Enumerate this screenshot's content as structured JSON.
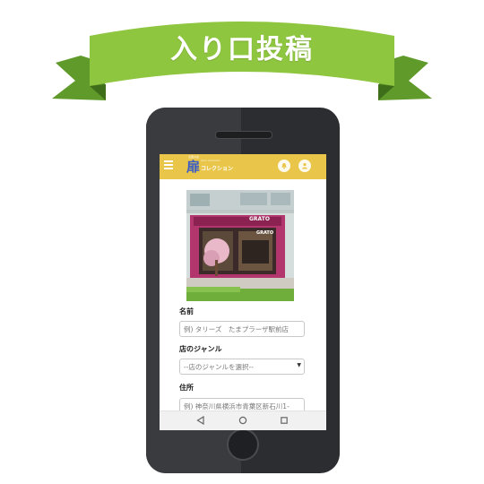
{
  "banner": {
    "title": "入り口投稿",
    "ribbon_color": "#8fc63f",
    "ribbon_dark": "#5f9a2a"
  },
  "app": {
    "logo_main": "扉",
    "logo_sub": "コレクション",
    "logo_tiny": "door collection",
    "logo_small": "全国の扉",
    "accent_color": "#e9c64a",
    "notification_icon": "bell-icon",
    "account_icon": "user-icon"
  },
  "photo": {
    "sign_text_1": "GRATO",
    "sign_text_2": "GRATO"
  },
  "form": {
    "name_label": "名前",
    "name_placeholder": "例) タリーズ　たまプラーザ駅前店",
    "genre_label": "店のジャンル",
    "genre_selected": "--店のジャンルを選択--",
    "address_label": "住所",
    "address_placeholder": "例) 神奈川県横浜市青葉区新石川1-"
  },
  "navbar": {
    "back_icon": "back-triangle-icon",
    "home_icon": "home-circle-icon",
    "recent_icon": "recent-square-icon"
  }
}
